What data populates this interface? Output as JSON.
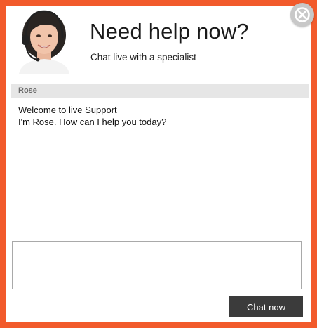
{
  "header": {
    "title": "Need help now?",
    "subtitle": "Chat live with a specialist",
    "avatar_icon": "support-agent-headset-avatar",
    "close_icon": "close-x-icon"
  },
  "conversation": {
    "agent_name": "Rose",
    "messages": [
      "Welcome to live Support",
      "I'm Rose. How can I help you today?"
    ]
  },
  "composer": {
    "input_value": "",
    "input_placeholder": "",
    "send_label": "Chat now"
  },
  "colors": {
    "frame_border": "#f25a2b",
    "agent_bar": "#e6e6e6",
    "send_button": "#3b3b3b",
    "close_button": "#c8c8c8"
  }
}
